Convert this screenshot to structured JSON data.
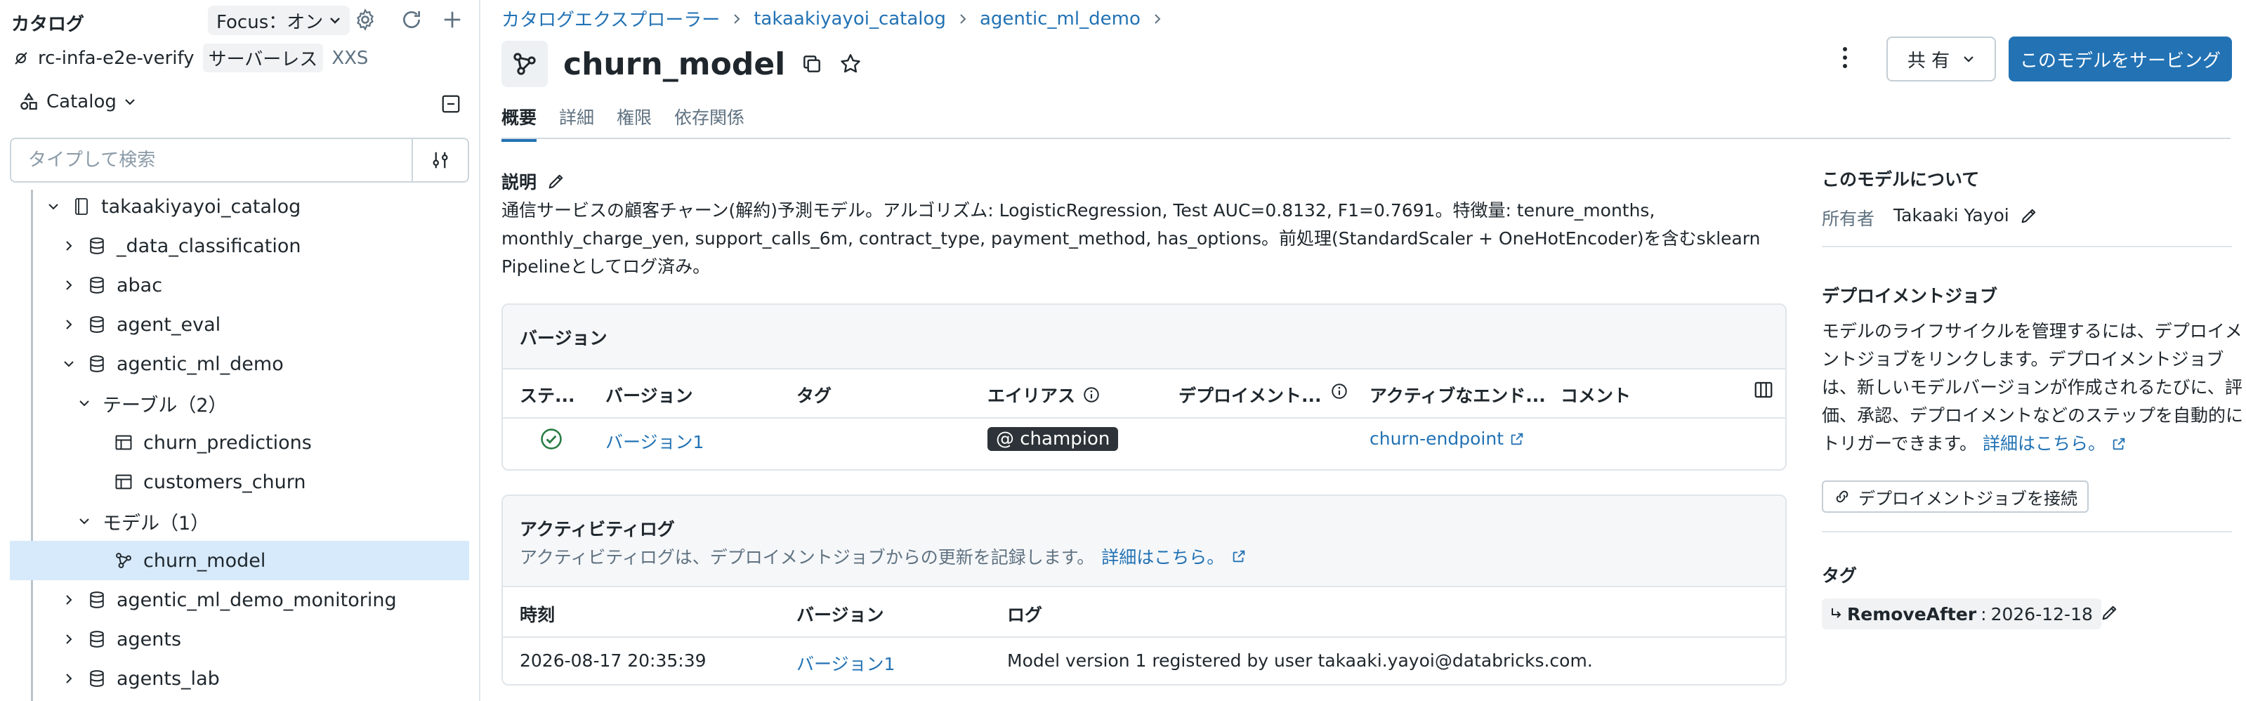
{
  "sidebar": {
    "title": "カタログ",
    "focus_label": "Focus：オン",
    "workspace": {
      "name": "rc-infa-e2e-verify",
      "badge": "サーバーレス",
      "size": "XXS"
    },
    "catalog_dropdown": "Catalog",
    "search_placeholder": "タイプして検索",
    "tree": [
      {
        "label": "takaakiyayoi_catalog",
        "icon": "catalog-icon",
        "expanded": true
      },
      {
        "label": "_data_classification",
        "icon": "database-icon",
        "expanded": false
      },
      {
        "label": "abac",
        "icon": "database-icon",
        "expanded": false
      },
      {
        "label": "agent_eval",
        "icon": "database-icon",
        "expanded": false
      },
      {
        "label": "agentic_ml_demo",
        "icon": "database-icon",
        "expanded": true
      },
      {
        "label": "テーブル（2）",
        "icon": "",
        "expanded": true
      },
      {
        "label": "churn_predictions",
        "icon": "table-icon"
      },
      {
        "label": "customers_churn",
        "icon": "table-icon"
      },
      {
        "label": "モデル（1）",
        "icon": "",
        "expanded": true
      },
      {
        "label": "churn_model",
        "icon": "model-icon",
        "selected": true
      },
      {
        "label": "agentic_ml_demo_monitoring",
        "icon": "database-icon",
        "expanded": false
      },
      {
        "label": "agents",
        "icon": "database-icon",
        "expanded": false
      },
      {
        "label": "agents_lab",
        "icon": "database-icon",
        "expanded": false
      }
    ]
  },
  "breadcrumb": [
    "カタログエクスプローラー",
    "takaakiyayoi_catalog",
    "agentic_ml_demo"
  ],
  "page_title": "churn_model",
  "header": {
    "share_label": "共 有",
    "serve_label": "このモデルをサービング"
  },
  "tabs": [
    "概要",
    "詳細",
    "権限",
    "依存関係"
  ],
  "description": {
    "label": "説明",
    "text": "通信サービスの顧客チャーン(解約)予測モデル。アルゴリズム: LogisticRegression, Test AUC=0.8132, F1=0.7691。特徴量: tenure_months, monthly_charge_yen, support_calls_6m, contract_type, payment_method, has_options。前処理(StandardScaler + OneHotEncoder)を含むsklearn Pipelineとしてログ済み。"
  },
  "versions": {
    "title": "バージョン",
    "columns": [
      "ステ...",
      "バージョン",
      "タグ",
      "エイリアス",
      "デプロイメント...",
      "アクティブなエンド...",
      "コメント"
    ],
    "rows": [
      {
        "status": "ready",
        "version": "バージョン1",
        "tag": "",
        "alias": "@ champion",
        "deployment": "",
        "endpoint": "churn-endpoint",
        "comment": ""
      }
    ]
  },
  "activity": {
    "title": "アクティビティログ",
    "subtitle": "アクティビティログは、デプロイメントジョブからの更新を記録します。",
    "learn_more": "詳細はこちら。",
    "columns": [
      "時刻",
      "バージョン",
      "ログ"
    ],
    "rows": [
      {
        "time": "2026-08-17 20:35:39",
        "version": "バージョン1",
        "log": "Model version 1 registered by user takaaki.yayoi@databricks.com."
      }
    ]
  },
  "about": {
    "title": "このモデルについて",
    "owner_label": "所有者",
    "owner": "Takaaki Yayoi",
    "deploy_title": "デプロイメントジョブ",
    "deploy_lines": [
      "モデルのライフサイクルを管理するには、デプロイメ",
      "ントジョブをリンクします。デプロイメントジョブ",
      "は、新しいモデルバージョンが作成されるたびに、評",
      "価、承認、デプロイメントなどのステップを自動的に",
      "トリガーできます。"
    ],
    "deploy_learn_more": "詳細はこちら。",
    "connect_label": "デプロイメントジョブを接続",
    "tags_title": "タグ",
    "tag_key": "RemoveAfter",
    "tag_value": "2026-12-18"
  },
  "colors": {
    "accent": "#2272b4",
    "selected_bg": "#d7eafb",
    "success": "#277c43"
  }
}
